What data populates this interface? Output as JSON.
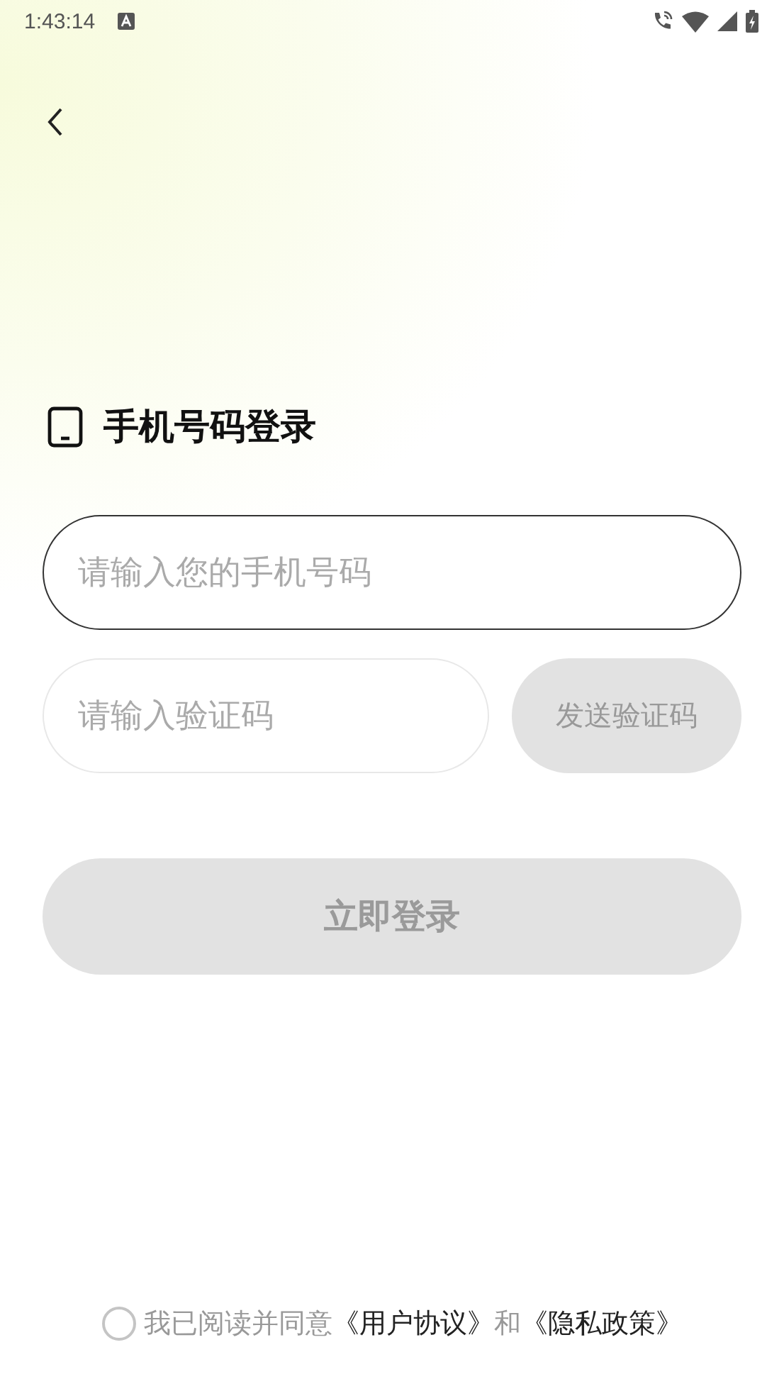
{
  "status_bar": {
    "time": "1:43:14"
  },
  "title": "手机号码登录",
  "phone_field": {
    "placeholder": "请输入您的手机号码",
    "focused": true
  },
  "code_field": {
    "placeholder": "请输入验证码",
    "focused": false
  },
  "send_code_button": {
    "label": "发送验证码",
    "disabled": true
  },
  "login_button": {
    "label": "立即登录",
    "disabled": true
  },
  "agreement": {
    "checked": false,
    "parts": [
      {
        "kind": "text",
        "text": "我已阅读并同意"
      },
      {
        "kind": "link",
        "text": "《用户协议》"
      },
      {
        "kind": "text",
        "text": "和"
      },
      {
        "kind": "link",
        "text": "《隐私政策》"
      }
    ]
  }
}
